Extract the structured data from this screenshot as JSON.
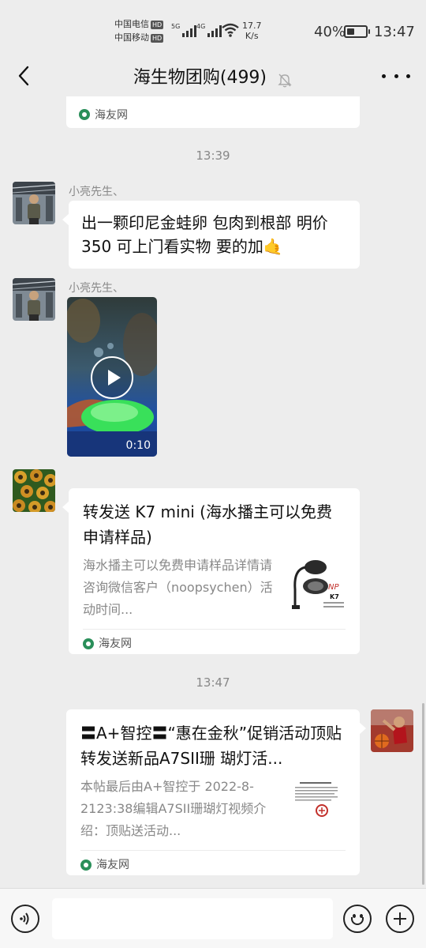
{
  "status_bar": {
    "carrier_1": "中国电信",
    "carrier_2": "中国移动",
    "hd_badge": "HD",
    "network_1": "5G",
    "network_2": "4G",
    "speed_value": "17.7",
    "speed_unit": "K/s",
    "battery_text": "40%",
    "battery_level": 0.4,
    "time": "13:47"
  },
  "header": {
    "title": "海生物团购(499)",
    "back_icon": "chevron-left-icon",
    "mute_icon": "bell-off-icon",
    "more_icon": "more-dots-icon"
  },
  "messages": {
    "top_card_source": "海友网",
    "timestamp_1": "13:39",
    "msg_1": {
      "sender": "小亮先生、",
      "text": "出一颗印尼金蛙卵 包肉到根部 明价 350 可上门看实物 要的加",
      "emoji": "🤙"
    },
    "msg_2": {
      "sender": "小亮先生、",
      "video_duration": "0:10"
    },
    "msg_3": {
      "title": "转发送 K7 mini (海水播主可以免费申请样品)",
      "desc": "海水播主可以免费申请样品详情请咨询微信客户（noopsychen）活动时间...",
      "thumb_brand": "NP",
      "thumb_model": "K7",
      "source": "海友网"
    },
    "timestamp_2": "13:47",
    "msg_4": {
      "title": "〓A+智控〓“惠在金秋”促销活动顶贴转发送新品A7SII珊 瑚灯活...",
      "desc": "本帖最后由A+智控于 2022-8-2123:38编辑A7SII珊瑚灯视频介绍：顶贴送活动...",
      "source": "海友网"
    }
  },
  "input_bar": {
    "voice_icon": "voice-icon",
    "emoji_icon": "smiley-icon",
    "plus_icon": "plus-icon",
    "placeholder": ""
  }
}
